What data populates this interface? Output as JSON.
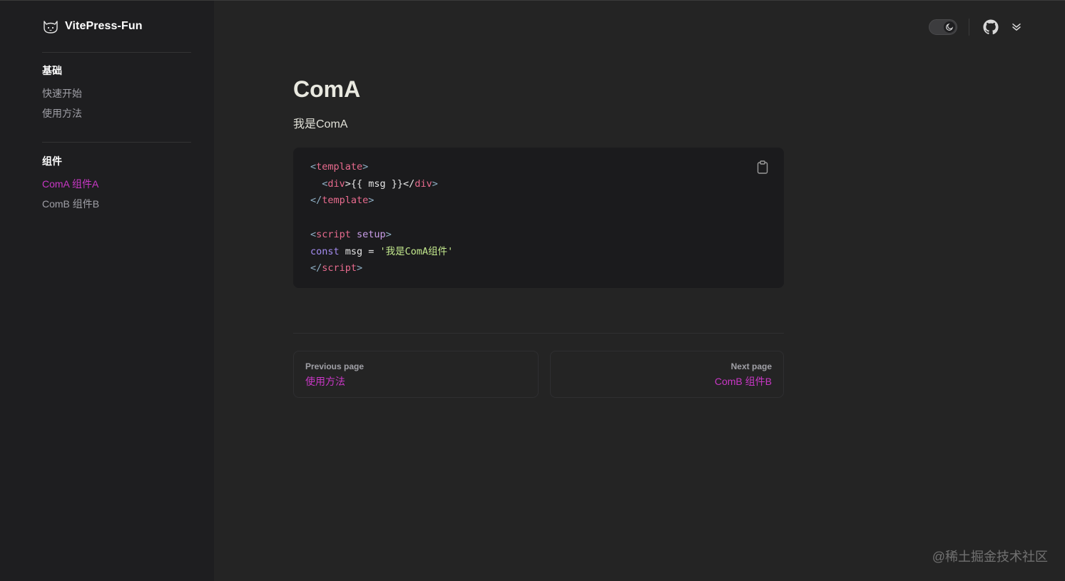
{
  "brand": {
    "title": "VitePress-Fun",
    "logo_icon": "cat-logo-icon"
  },
  "sidebar": {
    "groups": [
      {
        "heading": "基础",
        "items": [
          {
            "label": "快速开始",
            "active": false
          },
          {
            "label": "使用方法",
            "active": false
          }
        ]
      },
      {
        "heading": "组件",
        "items": [
          {
            "label": "ComA 组件A",
            "active": true
          },
          {
            "label": "ComB 组件B",
            "active": false
          }
        ]
      }
    ]
  },
  "nav": {
    "appearance_toggle_icon": "moon-icon",
    "github_icon": "github-icon",
    "extra_icon": "chevron-double-down-icon"
  },
  "main": {
    "title": "ComA",
    "intro": "我是ComA",
    "code": {
      "lines": [
        [
          "<",
          "template",
          ">"
        ],
        [
          "  <",
          "div",
          ">{{ msg }}</",
          "div",
          ">"
        ],
        [
          "</",
          "template",
          ">"
        ],
        [],
        [
          "<",
          "script",
          " setup",
          ">"
        ],
        [
          "const",
          " msg = ",
          "'我是ComA组件'"
        ],
        [
          "</",
          "script",
          ">"
        ]
      ],
      "copy_icon": "clipboard-icon"
    },
    "pager": {
      "prev": {
        "desc": "Previous page",
        "label": "使用方法"
      },
      "next": {
        "desc": "Next page",
        "label": "ComB 组件B"
      }
    }
  },
  "watermark": "@稀土掘金技术社区",
  "colors": {
    "accent": "#c837c5",
    "background": "#242424",
    "sidebar": "#1e1e20",
    "code_bg": "#1b1b1d"
  }
}
